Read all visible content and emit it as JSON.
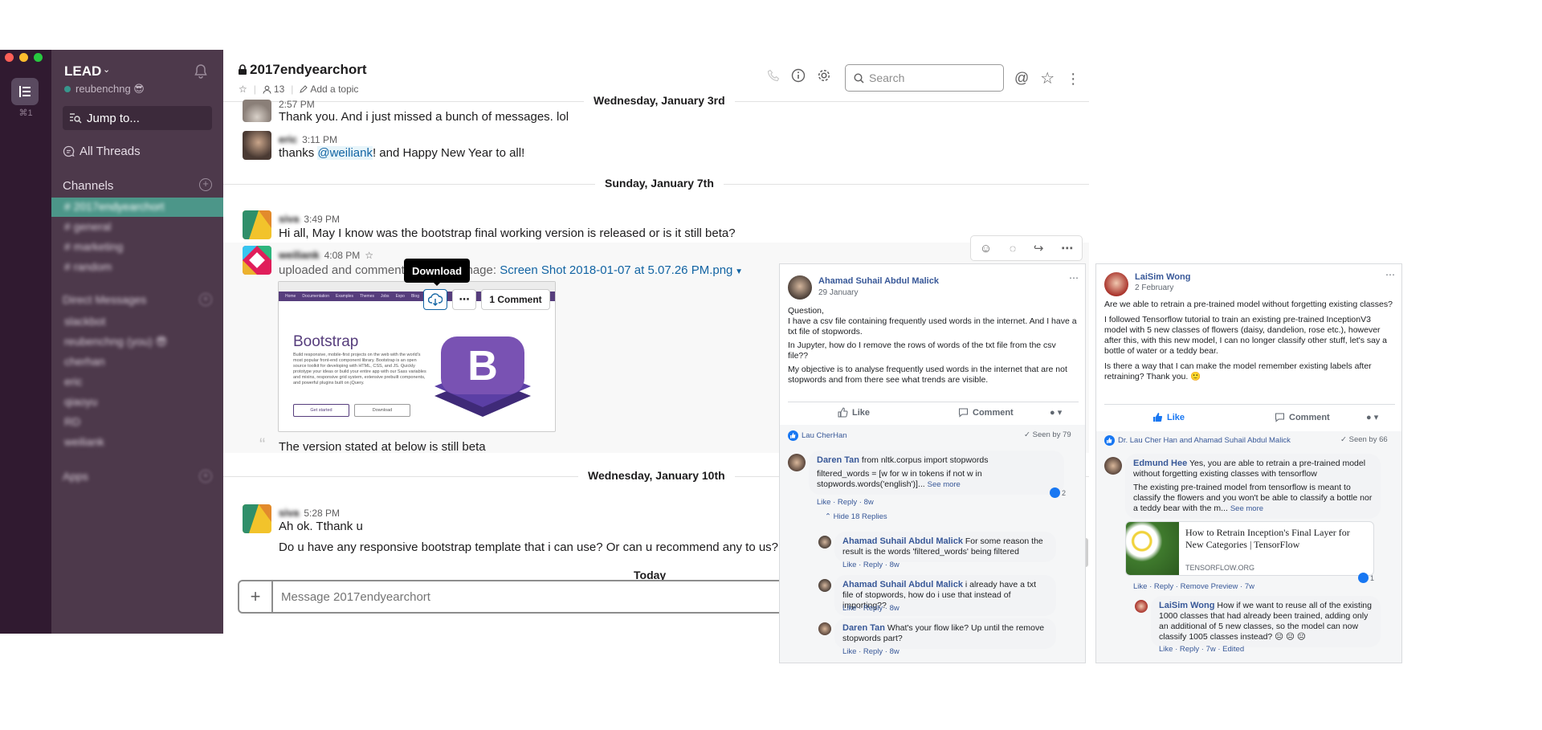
{
  "slack": {
    "shortcut": "⌘1",
    "team": "LEAD",
    "user": "reubenchng 😎",
    "jump_to": "Jump to...",
    "all_threads": "All Threads",
    "channels_heading": "Channels",
    "channels": [
      "# 2017endyearchort",
      "# general",
      "# marketing",
      "# random"
    ],
    "dm_heading": "Direct Messages",
    "dms": [
      "slackbot",
      "reubenchng (you) 😎",
      "cherhan",
      "eric",
      "qiaoyu",
      "RD",
      "weiliank"
    ],
    "apps_heading": "Apps",
    "channel": {
      "name": "2017endyearchort",
      "members": "13",
      "add_topic": "Add a topic"
    },
    "search_placeholder": "Search",
    "days": {
      "d1": "Wednesday, January 3rd",
      "d2": "Sunday, January 7th",
      "d3": "Wednesday, January 10th",
      "d4": "Today"
    },
    "messages": {
      "m0_time": "2:57 PM",
      "m0_text": "Thank you. And i just missed a bunch of messages. lol",
      "m1_name": "eric",
      "m1_time": "3:11 PM",
      "m1_pre": "thanks ",
      "m1_mention": "@weiliank",
      "m1_post": "! and Happy New Year to all!",
      "m2_name": "siva",
      "m2_time": "3:49 PM",
      "m2_text": "Hi all, May I know was the bootstrap final working version is released or is it still beta?",
      "m3_name": "weiliank",
      "m3_time": "4:08 PM",
      "m3_pre": "uploaded and commented on this image: ",
      "m3_file": "Screen Shot 2018-01-07 at 5.07.26 PM.png",
      "m3_comment": "The version stated at below is still beta",
      "m4_name": "siva",
      "m4_time": "5:28 PM",
      "m4_text1": "Ah ok. Tthank u",
      "m4_text2": "Do u have any responsive bootstrap template that i can use? Or can u recommend any to us?"
    },
    "tooltip": "Download",
    "comment_count": "1 Comment",
    "preview": {
      "nav": [
        "Home",
        "Documentation",
        "Examples",
        "Themes",
        "Jobs",
        "Expo",
        "Blog"
      ],
      "heading": "Bootstrap",
      "body": "Build responsive, mobile-first projects on the web with the world's most popular front-end component library. Bootstrap is an open source toolkit for developing with HTML, CSS, and JS. Quickly prototype your ideas or build your entire app with our Sass variables and mixins, responsive grid system, extensive prebuilt components, and powerful plugins built on jQuery.",
      "btn1": "Get started",
      "btn2": "Download"
    },
    "composer_placeholder": "Message 2017endyearchort"
  },
  "fb1": {
    "author": "Ahamad Suhail Abdul Malick",
    "date": "29 January",
    "p1": "Question,",
    "p2": "I have a csv file containing frequently used words in the internet. And I have a txt file of stopwords.",
    "p3": "In Jupyter, how do I remove the rows of words of the txt file from the csv file??",
    "p4": "My objective is to analyse frequently used words in the internet that are not stopwords and from there see what trends are visible.",
    "like": "Like",
    "comment": "Comment",
    "reactor": "Lau CherHan",
    "seen": "Seen by 79",
    "c1_name": "Daren Tan",
    "c1_text1": "from nltk.corpus import stopwords",
    "c1_text2": "filtered_words = [w for w in tokens if not w in stopwords.words('english')]...",
    "c1_more": "See more",
    "c1_likes": "2",
    "c1_actions": "Like · Reply · 8w",
    "hide_replies": "Hide 18 Replies",
    "r1_name": "Ahamad Suhail Abdul Malick",
    "r1_text": "For some reason the result is the words 'filtered_words' being filtered",
    "r1_actions": "Like · Reply · 8w",
    "r2_name": "Ahamad Suhail Abdul Malick",
    "r2_text": "i already have a txt file of stopwords, how do i use that instead of importing??",
    "r2_actions": "Like · Reply · 8w",
    "r3_name": "Daren Tan",
    "r3_text": "What's your flow like? Up until the remove stopwords part?",
    "r3_actions": "Like · Reply · 8w"
  },
  "fb2": {
    "author": "LaiSim Wong",
    "date": "2 February",
    "p1": "Are we able to retrain a pre-trained model without forgetting existing classes?",
    "p2": "I followed Tensorflow tutorial to train an existing pre-trained InceptionV3 model with 5 new classes of flowers (daisy, dandelion, rose etc.), however after this, with this new model, I can no longer classify other stuff, let's say a bottle of water or a teddy bear.",
    "p3": "Is there a way that I can make the model remember existing labels after retraining? Thank you. 🙂",
    "like": "Like",
    "comment": "Comment",
    "reactors": "Dr. Lau Cher Han and Ahamad Suhail Abdul Malick",
    "seen": "Seen by 66",
    "c1_name": "Edmund Hee",
    "c1_text1": "Yes, you are able to retrain a pre-trained model without forgetting existing classes with tensorflow",
    "c1_text2": "The existing pre-trained model from tensorflow is meant to classify the flowers and you won't be able to classify a bottle nor a teddy bear with the m...",
    "c1_more": "See more",
    "link_title": "How to Retrain Inception's Final Layer for New Categories  |  TensorFlow",
    "link_domain": "TENSORFLOW.ORG",
    "link_likes": "1",
    "c1_actions": "Like · Reply · Remove Preview · 7w",
    "r1_name": "LaiSim Wong",
    "r1_text": "How if we want to reuse all of the existing 1000 classes that had already been trained, adding only an additional of 5 new classes, so the model can now classify 1005 classes instead? 😐 😐 😐",
    "r1_actions": "Like · Reply · 7w · Edited"
  },
  "colors": {
    "sidebar": "#4d394b",
    "rail": "#301a30",
    "active_channel": "#4c9689",
    "link": "#1264a3",
    "fb_blue": "#385898"
  }
}
